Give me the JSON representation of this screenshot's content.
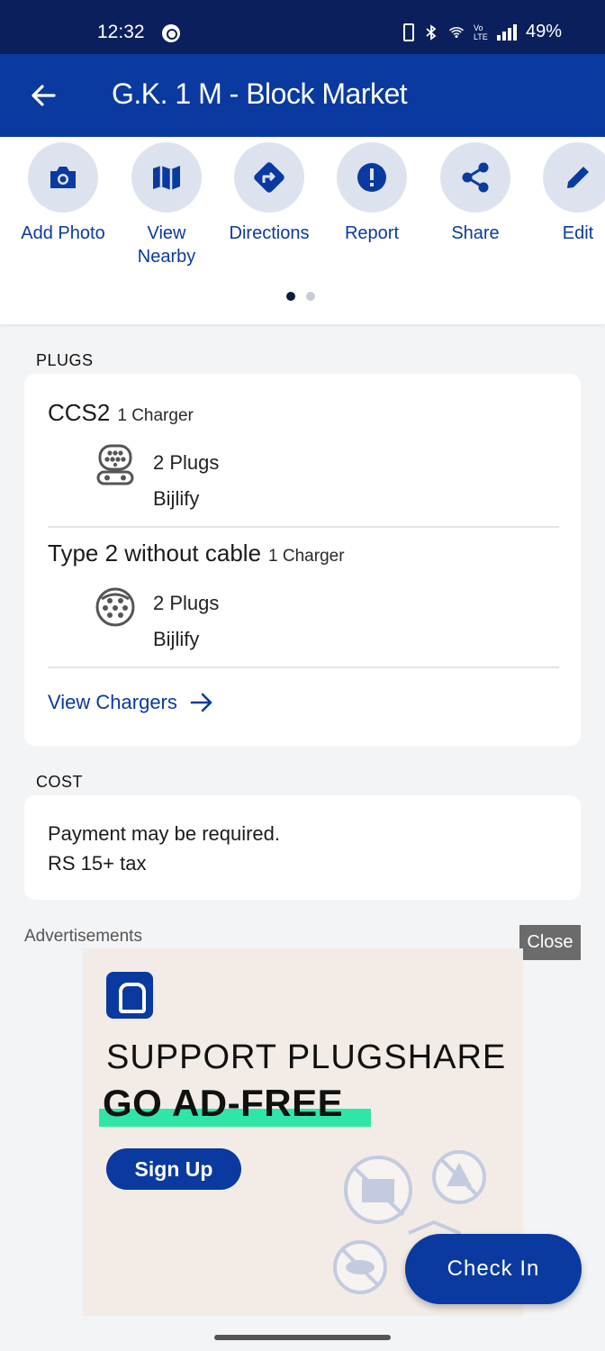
{
  "status_bar": {
    "time": "12:32",
    "battery": "49%",
    "network": "Vo LTE"
  },
  "app_bar": {
    "title": "G.K. 1 M - Block Market",
    "back_icon": "arrow-left-icon"
  },
  "actions": [
    {
      "label": "Add Photo",
      "icon": "camera-icon"
    },
    {
      "label": "View Nearby",
      "icon": "map-icon"
    },
    {
      "label": "Directions",
      "icon": "directions-icon"
    },
    {
      "label": "Report",
      "icon": "alert-icon"
    },
    {
      "label": "Share",
      "icon": "share-icon"
    },
    {
      "label": "Edit",
      "icon": "pencil-icon"
    }
  ],
  "pager": {
    "pages": 2,
    "active": 1
  },
  "plugs": {
    "section_title": "PLUGS",
    "items": [
      {
        "name": "CCS2",
        "chargers": "1 Charger",
        "plugs": "2 Plugs",
        "network": "Bijlify",
        "icon": "ccs2-connector-icon"
      },
      {
        "name": "Type 2 without cable",
        "chargers": "1 Charger",
        "plugs": "2 Plugs",
        "network": "Bijlify",
        "icon": "type2-connector-icon"
      }
    ],
    "view_chargers_label": "View Chargers"
  },
  "cost": {
    "section_title": "COST",
    "line1": "Payment may be required.",
    "line2": "RS 15+ tax"
  },
  "ads": {
    "label": "Advertisements",
    "close_label": "Close",
    "headline1": "SUPPORT PLUGSHARE",
    "headline2": "GO AD-FREE",
    "signup_label": "Sign Up"
  },
  "fab": {
    "label": "Check In"
  },
  "colors": {
    "primary": "#0a3aa0",
    "status_bar": "#0b1f5c",
    "highlight": "#2fe6a8"
  }
}
